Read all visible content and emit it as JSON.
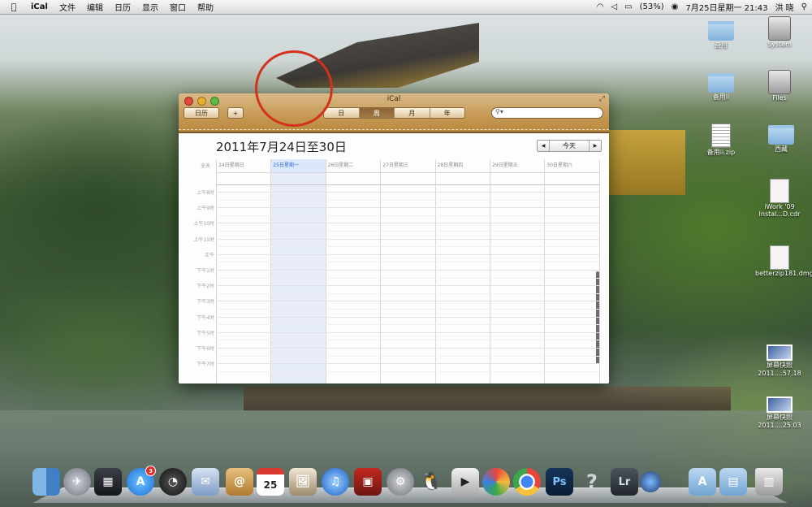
{
  "menubar": {
    "apple": "",
    "app_name": "iCal",
    "menus": [
      "文件",
      "编辑",
      "日历",
      "显示",
      "窗口",
      "帮助"
    ],
    "battery": "(53%)",
    "datetime": "7月25日星期一 21:43",
    "user": "洪 晓"
  },
  "window": {
    "title": "iCal",
    "calendars_button": "日历",
    "add_button": "+",
    "views": [
      "日",
      "周",
      "月",
      "年"
    ],
    "active_view": "周",
    "search_placeholder": ""
  },
  "calendar": {
    "range_title": "2011年7月24日至30日",
    "today_button": "今天",
    "prev": "◀",
    "next": "▶",
    "allday_label": "全天",
    "days": [
      "24日星期日",
      "25日星期一",
      "26日星期二",
      "27日星期三",
      "28日星期四",
      "29日星期五",
      "30日星期六"
    ],
    "today_index": 1,
    "hours": [
      "上午8时",
      "上午9时",
      "上午10时",
      "上午11时",
      "正午",
      "下午1时",
      "下午2时",
      "下午3时",
      "下午4时",
      "下午5时",
      "下午6时",
      "下午7时"
    ]
  },
  "desktop_icons": [
    {
      "label": "备用",
      "kind": "folder"
    },
    {
      "label": "System",
      "kind": "disk"
    },
    {
      "label": "备用ii",
      "kind": "folder"
    },
    {
      "label": "Files",
      "kind": "disk"
    },
    {
      "label": "备用ii.zip",
      "kind": "zip"
    },
    {
      "label": "西藏",
      "kind": "folder"
    },
    {
      "label": "iWork '09 Instal...D.cdr",
      "kind": "doc"
    },
    {
      "label": "betterzip181.dmg",
      "kind": "doc"
    },
    {
      "label": "屏幕快照 2011....57.18",
      "kind": "screenshot"
    },
    {
      "label": "屏幕快照 2011....25.03",
      "kind": "screenshot"
    }
  ],
  "dock": {
    "calendar_day": "25",
    "appstore_badge": "3",
    "photoshop": "Ps",
    "lightroom": "Lr",
    "help": "?"
  }
}
